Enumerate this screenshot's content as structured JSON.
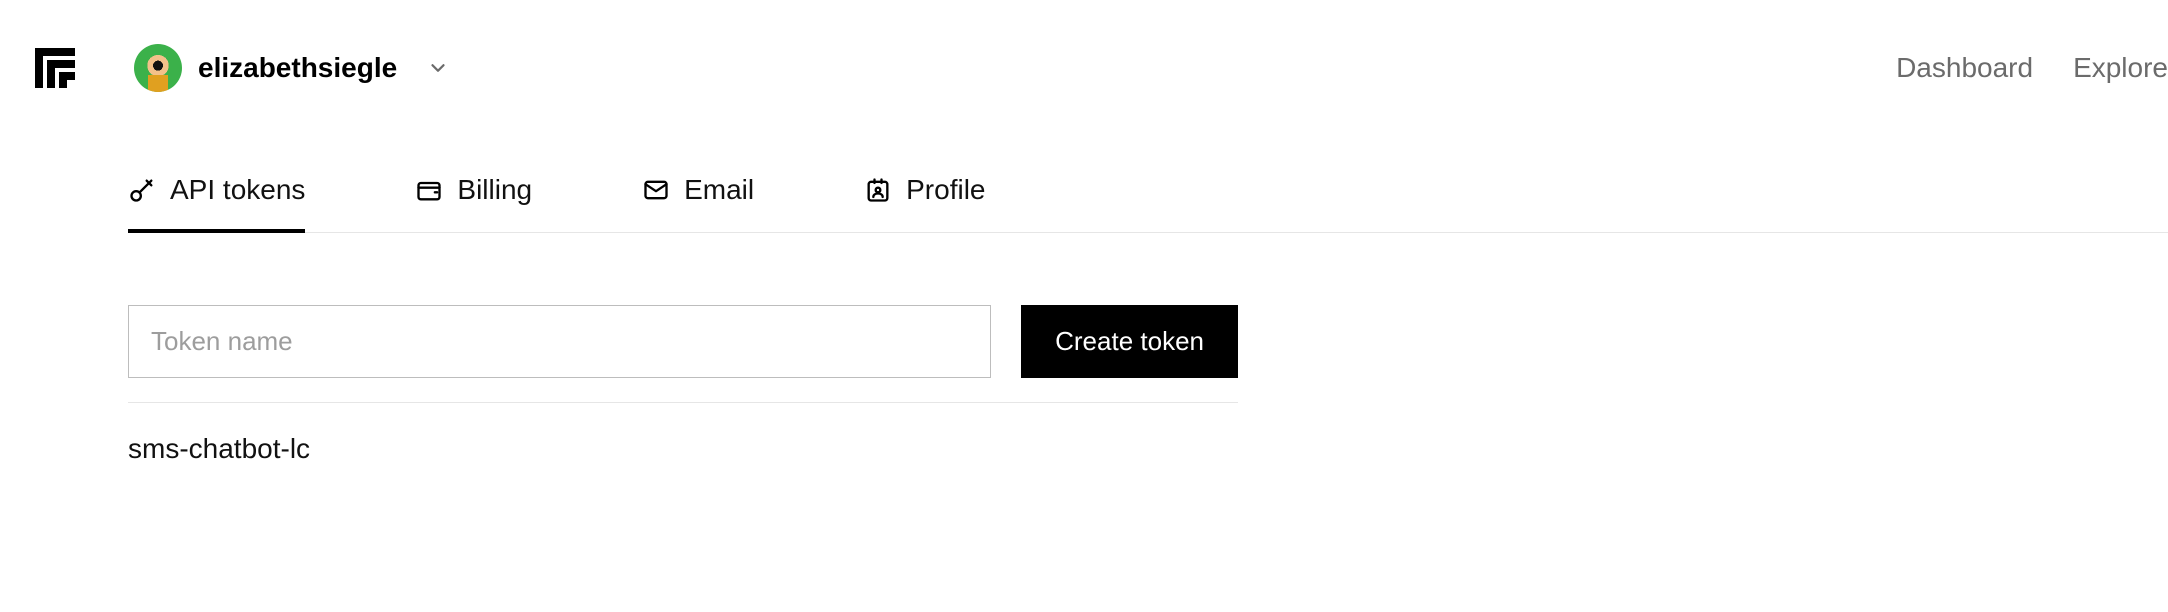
{
  "header": {
    "username": "elizabethsiegle",
    "nav": {
      "dashboard": "Dashboard",
      "explore": "Explore"
    }
  },
  "tabs": {
    "api_tokens": "API tokens",
    "billing": "Billing",
    "email": "Email",
    "profile": "Profile"
  },
  "token_form": {
    "placeholder": "Token name",
    "value": "",
    "create_label": "Create token"
  },
  "tokens": [
    {
      "name": "sms-chatbot-lc"
    }
  ]
}
